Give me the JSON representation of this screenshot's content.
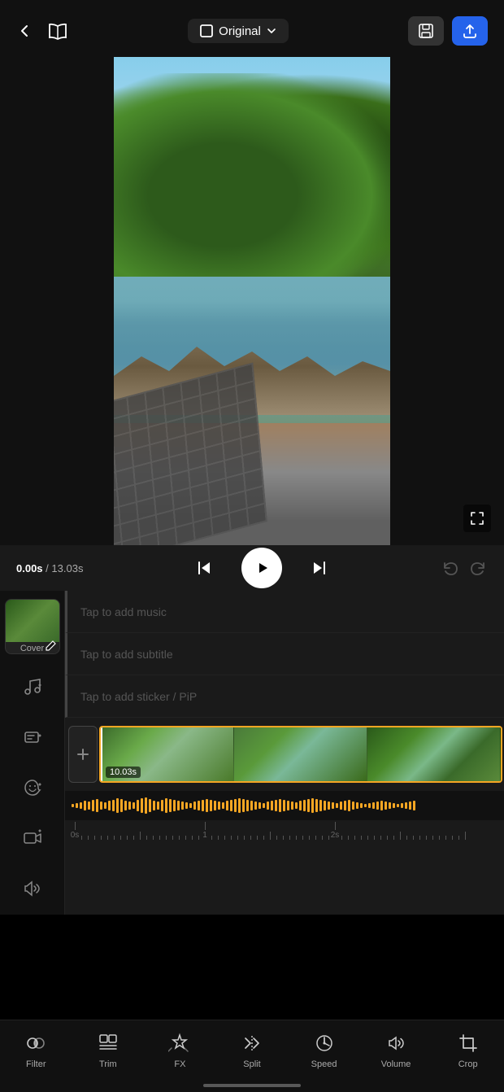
{
  "topBar": {
    "backLabel": "Back",
    "bookLabel": "Book",
    "aspectRatio": {
      "icon": "aspect-ratio-icon",
      "label": "Original",
      "chevron": "chevron-down-icon"
    },
    "saveLabel": "Save",
    "exportLabel": "Export"
  },
  "playback": {
    "currentTime": "0.00s",
    "totalTime": "13.03s",
    "separator": "/"
  },
  "timeline": {
    "tracks": {
      "music": "Tap to add music",
      "subtitle": "Tap to add subtitle",
      "sticker": "Tap to add sticker / PiP"
    },
    "clip": {
      "duration": "10.03s"
    },
    "ruler": {
      "marks": [
        "0s",
        "1",
        "2s"
      ]
    }
  },
  "cover": {
    "label": "Cover"
  },
  "toolbar": {
    "items": [
      {
        "id": "filter",
        "label": "Filter"
      },
      {
        "id": "trim",
        "label": "Trim"
      },
      {
        "id": "fx",
        "label": "FX"
      },
      {
        "id": "split",
        "label": "Split"
      },
      {
        "id": "speed",
        "label": "Speed"
      },
      {
        "id": "volume",
        "label": "Volume"
      },
      {
        "id": "crop",
        "label": "Crop"
      }
    ]
  },
  "colors": {
    "accent": "#f5a623",
    "blue": "#2563eb",
    "bg": "#000000",
    "surface": "#1a1a1a"
  }
}
